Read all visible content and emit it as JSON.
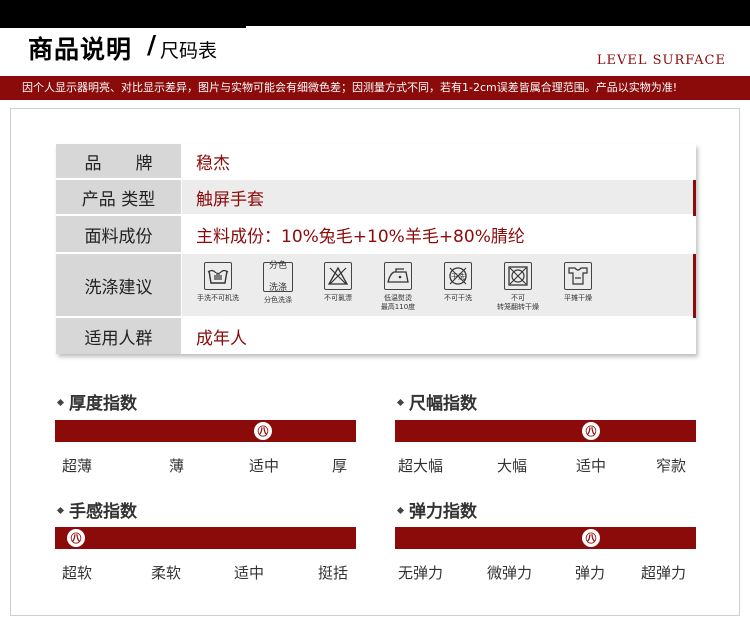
{
  "header": {
    "title_main": "商品说明",
    "title_slash": "/",
    "title_sub": "尺码表",
    "brand_en": "LEVEL SURFACE",
    "notice": "因个人显示器明亮、对比显示差异，图片与实物可能会有细微色差；因测量方式不同，若有1-2cm误差皆属合理范围。产品以实物为准!"
  },
  "specs": {
    "brand": {
      "label": "品　　牌",
      "value": "稳杰"
    },
    "type": {
      "label": "产品 类型",
      "value": "触屏手套"
    },
    "fabric": {
      "label": "面料成份",
      "value": "主料成份：10%兔毛+10%羊毛+80%腈纶"
    },
    "wash": {
      "label": "洗涤建议"
    },
    "people": {
      "label": "适用人群",
      "value": "成年人"
    }
  },
  "care_items": [
    {
      "icon": "hand-wash-icon",
      "label": "手洗不可机洗"
    },
    {
      "icon": "separate-wash-icon",
      "glyph_line1": "分色",
      "glyph_line2": "洗涤",
      "label": "分色洗涤"
    },
    {
      "icon": "no-bleach-icon",
      "label": "不可氯漂"
    },
    {
      "icon": "low-iron-icon",
      "label": "低温熨烫",
      "label2": "最高110度"
    },
    {
      "icon": "no-dry-clean-icon",
      "label": "不可干洗"
    },
    {
      "icon": "no-tumble-dry-icon",
      "label": "不可",
      "label2": "转笼翻转干燥"
    },
    {
      "icon": "flat-dry-icon",
      "label": "平摊干燥"
    }
  ],
  "indexes": {
    "thickness": {
      "title": "厚度指数",
      "labels": [
        "超薄",
        "薄",
        "适中",
        "厚"
      ],
      "marker_glyph": "㊇",
      "level": 0.69
    },
    "size": {
      "title": "尺幅指数",
      "labels": [
        "超大幅",
        "大幅",
        "适中",
        "窄款"
      ],
      "marker_glyph": "㊇",
      "level": 0.65
    },
    "feel": {
      "title": "手感指数",
      "labels": [
        "超软",
        "柔软",
        "适中",
        "挺括"
      ],
      "marker_glyph": "㊇",
      "level": 0.07
    },
    "elastic": {
      "title": "弹力指数",
      "labels": [
        "无弹力",
        "微弹力",
        "弹力",
        "超弹力"
      ],
      "marker_glyph": "㊇",
      "level": 0.65
    }
  },
  "colors": {
    "accent": "#8b0a0a",
    "label_bg": "#d7d7d7",
    "shade_bg": "#ececec"
  }
}
